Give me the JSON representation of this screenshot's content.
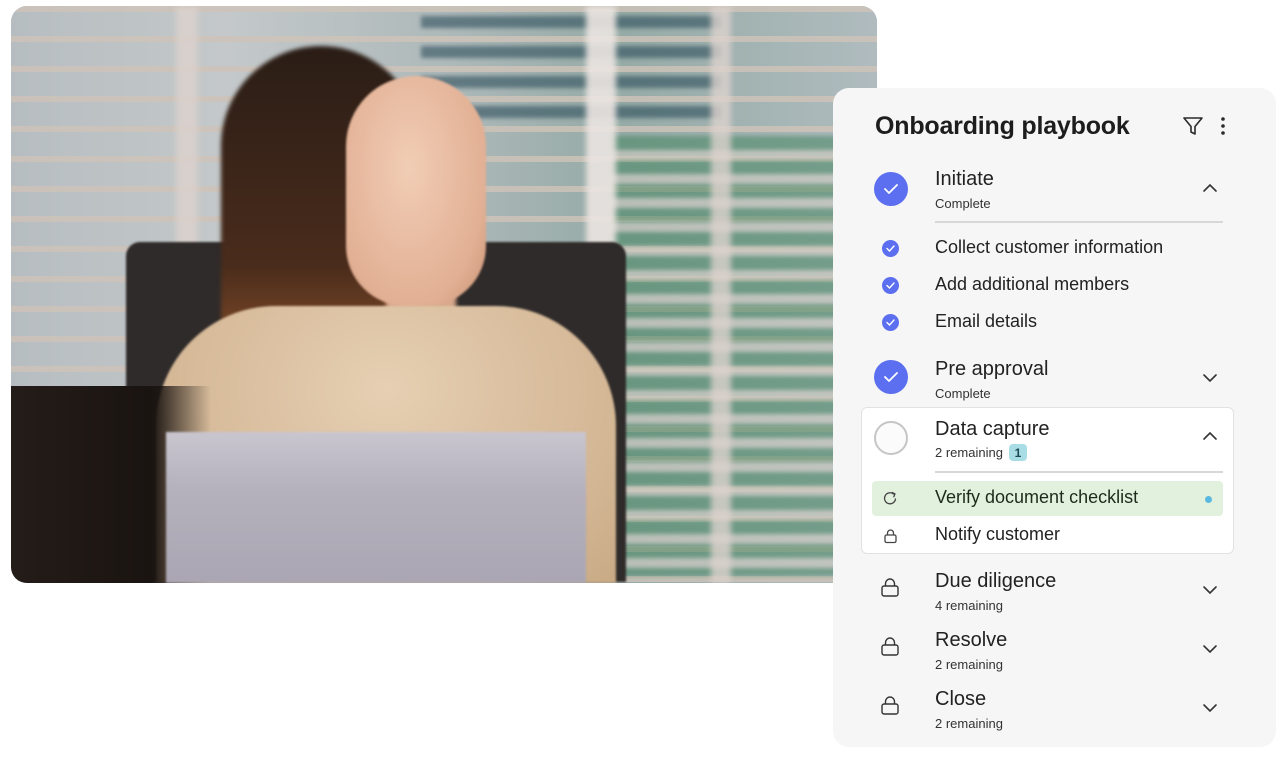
{
  "photo": {
    "alt": "Smiling woman seated at a laptop in an office"
  },
  "panel": {
    "title": "Onboarding playbook",
    "icons": {
      "filter": "filter-icon",
      "more": "more-vertical-icon"
    },
    "colors": {
      "accent": "#5b6ff0",
      "highlight": "#e2f1dd",
      "badge": "#a9dde6",
      "status_dot": "#5ab8e0",
      "panel_bg": "#f6f6f6"
    },
    "stages": [
      {
        "title": "Initiate",
        "subtitle": "Complete",
        "status": "complete",
        "expanded": true,
        "tasks": [
          {
            "label": "Collect customer information",
            "status": "complete"
          },
          {
            "label": "Add additional members",
            "status": "complete"
          },
          {
            "label": "Email details",
            "status": "complete"
          }
        ]
      },
      {
        "title": "Pre approval",
        "subtitle": "Complete",
        "status": "complete",
        "expanded": false
      },
      {
        "title": "Data capture",
        "subtitle": "2 remaining",
        "badge": "1",
        "status": "in-progress",
        "expanded": true,
        "tasks": [
          {
            "label": "Verify document checklist",
            "status": "in-progress",
            "icon": "refresh-icon",
            "active": true
          },
          {
            "label": "Notify customer",
            "status": "locked",
            "icon": "lock-icon"
          }
        ]
      },
      {
        "title": "Due diligence",
        "subtitle": "4 remaining",
        "status": "locked",
        "expanded": false
      },
      {
        "title": "Resolve",
        "subtitle": "2 remaining",
        "status": "locked",
        "expanded": false
      },
      {
        "title": "Close",
        "subtitle": "2 remaining",
        "status": "locked",
        "expanded": false
      }
    ]
  }
}
